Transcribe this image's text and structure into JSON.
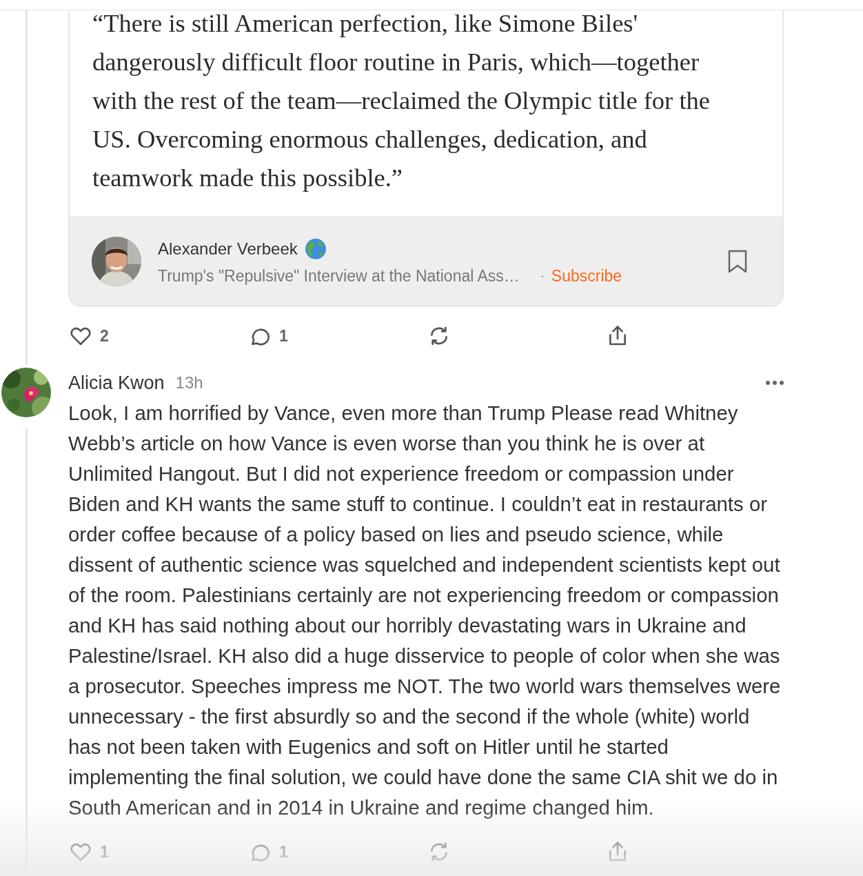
{
  "quote_card": {
    "text": "“There is still American perfection, like Simone Biles' dangerously difficult floor routine in Paris, which—together with the rest of the team—reclaimed the Olympic title for the US. Overcoming enormous challenges, dedication, and teamwork made this possible.”",
    "author": "Alexander Verbeek",
    "post_title": "Trump's \"Repulsive\" Interview at the National Ass…",
    "separator": "·",
    "subscribe": "Subscribe"
  },
  "post_actions": {
    "likes": "2",
    "comments": "1"
  },
  "comment": {
    "author": "Alicia Kwon",
    "time": "13h",
    "text": "Look, I am horrified by Vance, even more than Trump Please read Whitney Webb’s article on how Vance is even worse than you think he is over at Unlimited Hangout. But I did not experience freedom or compassion under Biden and KH wants the same stuff to continue. I couldn’t eat in restaurants or order coffee because of a policy based on lies and pseudo science, while dissent of authentic science was squelched and independent scientists kept out of the room. Palestinians certainly are not experiencing freedom or compassion and KH has said nothing about our horribly devastating wars in Ukraine and Palestine/Israel. KH also did a huge disservice to people of color when she was a prosecutor. Speeches impress me NOT. The two world wars themselves were unnecessary - the first absurdly so and the second if the whole (white) world has not been taken with Eugenics and soft on Hitler until he started implementing the final solution, we could have done the same CIA shit we do in South American and in 2014 in Ukraine and regime changed him.",
    "actions": {
      "likes": "1",
      "comments": "1"
    }
  }
}
